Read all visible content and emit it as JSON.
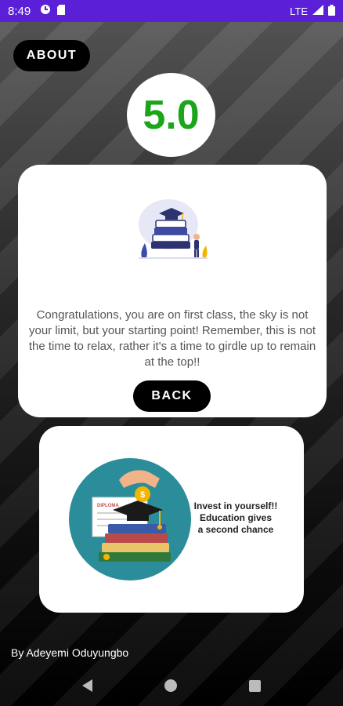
{
  "status_bar": {
    "time": "8:49",
    "network": "LTE"
  },
  "about_label": "ABOUT",
  "score": "5.0",
  "message": "Congratulations, you are on first class, the sky is not your limit, but your starting point! Remember, this is not the time to relax, rather it's a time to girdle up to remain at the top!!",
  "back_label": "BACK",
  "banner": {
    "diploma_text": "DIPLOMA",
    "tagline_lines": [
      "Invest in yourself!!",
      "Education gives",
      "a second chance"
    ]
  },
  "credit": "By Adeyemi Oduyungbo",
  "colors": {
    "status_bar": "#5a1fd6",
    "score": "#1aa51a",
    "banner_circle": "#2a8d99",
    "coin": "#f4b400"
  },
  "icons": [
    "graduation-cap-icon",
    "signal-icon",
    "battery-icon"
  ]
}
